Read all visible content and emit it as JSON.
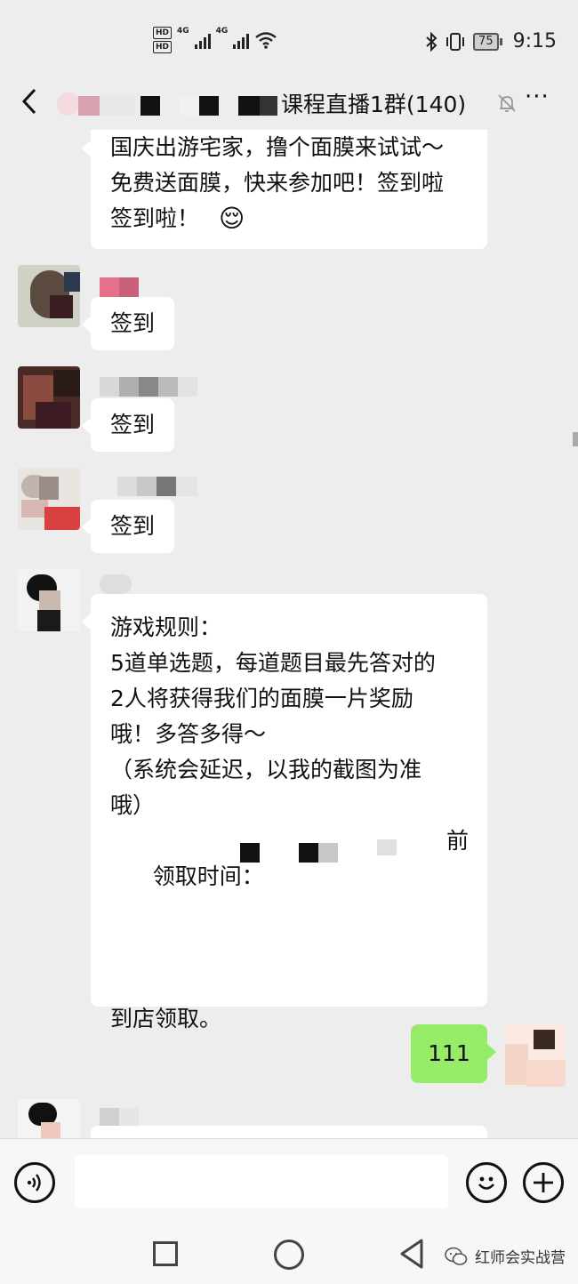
{
  "status_bar": {
    "hd1": "HD",
    "hd2": "HD",
    "net1": "4G",
    "net2": "4G",
    "battery": "75",
    "time": "9:15"
  },
  "header": {
    "title": "课程直播1群(140)"
  },
  "messages": {
    "m1": {
      "lines": [
        "国庆出游宅家，撸个面膜来试试～",
        "免费送面膜，快来参加吧！签到啦",
        "签到啦！"
      ],
      "emoji": "😌"
    },
    "m2": {
      "text": "签到"
    },
    "m3": {
      "text": "签到"
    },
    "m4": {
      "text": "签到"
    },
    "m5": {
      "lines": [
        "游戏规则：",
        "",
        "5道单选题，每道题目最先答对的",
        "2人将获得我们的面膜一片奖励",
        "哦！多答多得～",
        "",
        "（系统会延迟，以我的截图为准",
        "哦）",
        "",
        "领取时间：",
        "到店领取。"
      ],
      "tail_after_blur": "前"
    },
    "m6": {
      "text": "111"
    }
  },
  "input_bar": {
    "placeholder": ""
  },
  "watermark": {
    "text": "红师会实战营"
  },
  "colors": {
    "background": "#ededed",
    "bubble_self": "#95ec69",
    "bubble_other": "#ffffff"
  }
}
